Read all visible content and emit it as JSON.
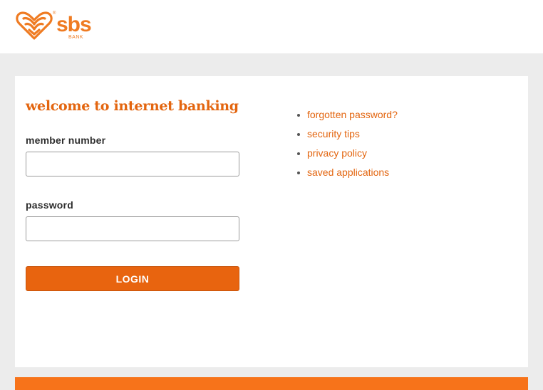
{
  "brand": {
    "name": "sbs",
    "subtitle": "BANK",
    "reg_mark": "®",
    "color": "#ef7b22"
  },
  "login": {
    "heading": "welcome to internet banking",
    "member_label": "member number",
    "member_value": "",
    "password_label": "password",
    "password_value": "",
    "button_label": "LOGIN"
  },
  "links": [
    {
      "label": "forgotten password?"
    },
    {
      "label": "security tips"
    },
    {
      "label": "privacy policy"
    },
    {
      "label": "saved applications"
    }
  ],
  "colors": {
    "accent": "#e8640f",
    "footer": "#f7731a",
    "background": "#ececec"
  }
}
